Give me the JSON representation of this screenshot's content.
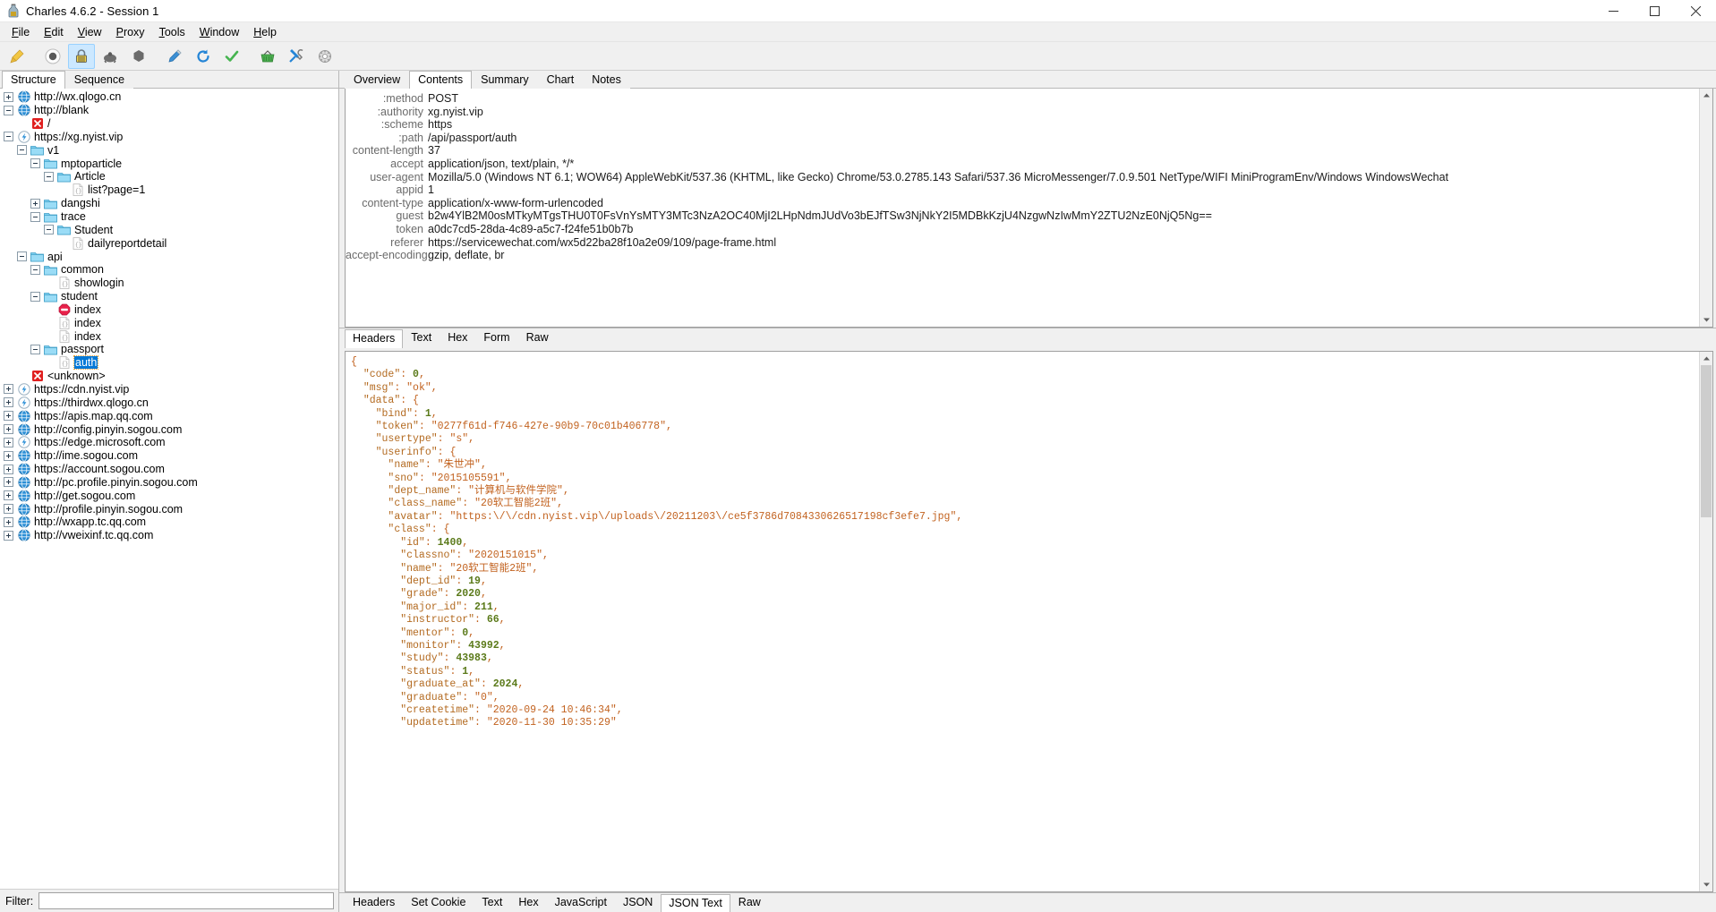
{
  "window": {
    "title": "Charles 4.6.2 - Session 1",
    "app_icon": "charles-bottle-icon",
    "minimize": "minimize-icon",
    "maximize": "maximize-icon",
    "close": "close-icon"
  },
  "menubar": [
    {
      "label": "File",
      "mnemonic": "F"
    },
    {
      "label": "Edit",
      "mnemonic": "E"
    },
    {
      "label": "View",
      "mnemonic": "V"
    },
    {
      "label": "Proxy",
      "mnemonic": "P"
    },
    {
      "label": "Tools",
      "mnemonic": "T"
    },
    {
      "label": "Window",
      "mnemonic": "W"
    },
    {
      "label": "Help",
      "mnemonic": "H"
    }
  ],
  "toolbar": [
    {
      "name": "clear-session-icon",
      "tip": "Clear the current session",
      "active": false
    },
    {
      "name": "record-icon",
      "tip": "Start/Stop Recording",
      "active": false
    },
    {
      "name": "ssl-proxying-icon",
      "tip": "SSL Proxying Settings",
      "active": true
    },
    {
      "name": "throttle-icon",
      "tip": "Start/Stop Throttling",
      "active": false
    },
    {
      "name": "breakpoints-icon",
      "tip": "Enable/Disable Breakpoints",
      "active": false
    },
    {
      "name": "compose-icon",
      "tip": "Compose a new request",
      "active": false
    },
    {
      "name": "repeat-icon",
      "tip": "Repeat the request",
      "active": false
    },
    {
      "name": "validate-icon",
      "tip": "Validate the recording",
      "active": false
    },
    {
      "name": "tools-basket-icon",
      "tip": "Tools",
      "active": false
    },
    {
      "name": "settings-tools-icon",
      "tip": "Settings",
      "active": false
    },
    {
      "name": "dns-spoofing-icon",
      "tip": "DNS Spoofing",
      "active": false
    }
  ],
  "left_pane": {
    "tabs": [
      {
        "label": "Structure",
        "selected": true
      },
      {
        "label": "Sequence",
        "selected": false
      }
    ],
    "filter": {
      "label": "Filter:",
      "value": "",
      "placeholder": ""
    },
    "tree": [
      {
        "indent": 0,
        "expander": "plus",
        "icon": "globe-icon",
        "label": "http://wx.qlogo.cn",
        "selected": false
      },
      {
        "indent": 0,
        "expander": "minus",
        "icon": "globe-icon",
        "label": "http://blank",
        "selected": false
      },
      {
        "indent": 1,
        "expander": "none",
        "icon": "error-icon",
        "label": "/",
        "selected": false
      },
      {
        "indent": 0,
        "expander": "minus",
        "icon": "ssl-icon",
        "label": "https://xg.nyist.vip",
        "selected": false
      },
      {
        "indent": 1,
        "expander": "minus",
        "icon": "folder-icon",
        "label": "v1",
        "selected": false
      },
      {
        "indent": 2,
        "expander": "minus",
        "icon": "folder-icon",
        "label": "mptoparticle",
        "selected": false
      },
      {
        "indent": 3,
        "expander": "minus",
        "icon": "folder-icon",
        "label": "Article",
        "selected": false
      },
      {
        "indent": 4,
        "expander": "none",
        "icon": "json-icon",
        "label": "list?page=1",
        "selected": false
      },
      {
        "indent": 2,
        "expander": "plus",
        "icon": "folder-icon",
        "label": "dangshi",
        "selected": false
      },
      {
        "indent": 2,
        "expander": "minus",
        "icon": "folder-icon",
        "label": "trace",
        "selected": false
      },
      {
        "indent": 3,
        "expander": "minus",
        "icon": "folder-icon",
        "label": "Student",
        "selected": false
      },
      {
        "indent": 4,
        "expander": "none",
        "icon": "json-icon",
        "label": "dailyreportdetail",
        "selected": false
      },
      {
        "indent": 1,
        "expander": "minus",
        "icon": "folder-icon",
        "label": "api",
        "selected": false
      },
      {
        "indent": 2,
        "expander": "minus",
        "icon": "folder-icon",
        "label": "common",
        "selected": false
      },
      {
        "indent": 3,
        "expander": "none",
        "icon": "json-icon",
        "label": "showlogin",
        "selected": false
      },
      {
        "indent": 2,
        "expander": "minus",
        "icon": "folder-icon",
        "label": "student",
        "selected": false
      },
      {
        "indent": 3,
        "expander": "none",
        "icon": "stop-icon",
        "label": "index",
        "selected": false
      },
      {
        "indent": 3,
        "expander": "none",
        "icon": "json-icon",
        "label": "index",
        "selected": false
      },
      {
        "indent": 3,
        "expander": "none",
        "icon": "json-icon",
        "label": "index",
        "selected": false
      },
      {
        "indent": 2,
        "expander": "minus",
        "icon": "folder-icon",
        "label": "passport",
        "selected": false
      },
      {
        "indent": 3,
        "expander": "none",
        "icon": "json-icon",
        "label": "auth",
        "selected": true
      },
      {
        "indent": 1,
        "expander": "none",
        "icon": "error-icon",
        "label": "<unknown>",
        "selected": false
      },
      {
        "indent": 0,
        "expander": "plus",
        "icon": "ssl-icon",
        "label": "https://cdn.nyist.vip",
        "selected": false
      },
      {
        "indent": 0,
        "expander": "plus",
        "icon": "ssl-icon",
        "label": "https://thirdwx.qlogo.cn",
        "selected": false
      },
      {
        "indent": 0,
        "expander": "plus",
        "icon": "globe-icon",
        "label": "https://apis.map.qq.com",
        "selected": false
      },
      {
        "indent": 0,
        "expander": "plus",
        "icon": "globe-icon",
        "label": "http://config.pinyin.sogou.com",
        "selected": false
      },
      {
        "indent": 0,
        "expander": "plus",
        "icon": "ssl-icon",
        "label": "https://edge.microsoft.com",
        "selected": false
      },
      {
        "indent": 0,
        "expander": "plus",
        "icon": "globe-icon",
        "label": "http://ime.sogou.com",
        "selected": false
      },
      {
        "indent": 0,
        "expander": "plus",
        "icon": "globe-icon",
        "label": "https://account.sogou.com",
        "selected": false
      },
      {
        "indent": 0,
        "expander": "plus",
        "icon": "globe-icon",
        "label": "http://pc.profile.pinyin.sogou.com",
        "selected": false
      },
      {
        "indent": 0,
        "expander": "plus",
        "icon": "globe-icon",
        "label": "http://get.sogou.com",
        "selected": false
      },
      {
        "indent": 0,
        "expander": "plus",
        "icon": "globe-icon",
        "label": "http://profile.pinyin.sogou.com",
        "selected": false
      },
      {
        "indent": 0,
        "expander": "plus",
        "icon": "globe-icon",
        "label": "http://wxapp.tc.qq.com",
        "selected": false
      },
      {
        "indent": 0,
        "expander": "plus",
        "icon": "globe-icon",
        "label": "http://vweixinf.tc.qq.com",
        "selected": false
      }
    ]
  },
  "request": {
    "tabs": [
      {
        "label": "Overview",
        "selected": false
      },
      {
        "label": "Contents",
        "selected": true
      },
      {
        "label": "Summary",
        "selected": false
      },
      {
        "label": "Chart",
        "selected": false
      },
      {
        "label": "Notes",
        "selected": false
      }
    ],
    "sub_tabs": [
      {
        "label": "Headers",
        "selected": true
      },
      {
        "label": "Text",
        "selected": false
      },
      {
        "label": "Hex",
        "selected": false
      },
      {
        "label": "Form",
        "selected": false
      },
      {
        "label": "Raw",
        "selected": false
      }
    ],
    "headers": [
      {
        "name": ":method",
        "value": "POST"
      },
      {
        "name": ":authority",
        "value": "xg.nyist.vip"
      },
      {
        "name": ":scheme",
        "value": "https"
      },
      {
        "name": ":path",
        "value": "/api/passport/auth"
      },
      {
        "name": "content-length",
        "value": "37"
      },
      {
        "name": "accept",
        "value": "application/json, text/plain, */*"
      },
      {
        "name": "user-agent",
        "value": "Mozilla/5.0 (Windows NT 6.1; WOW64) AppleWebKit/537.36 (KHTML, like Gecko) Chrome/53.0.2785.143 Safari/537.36 MicroMessenger/7.0.9.501 NetType/WIFI MiniProgramEnv/Windows WindowsWechat"
      },
      {
        "name": "appid",
        "value": "1"
      },
      {
        "name": "content-type",
        "value": "application/x-www-form-urlencoded"
      },
      {
        "name": "guest",
        "value": "b2w4YlB2M0osMTkyMTgsTHU0T0FsVnYsMTY3MTc3NzA2OC40MjI2LHpNdmJUdVo3bEJfTSw3NjNkY2I5MDBkKzjU4NzgwNzIwMmY2ZTU2NzE0NjQ5Ng=="
      },
      {
        "name": "token",
        "value": "a0dc7cd5-28da-4c89-a5c7-f24fe51b0b7b"
      },
      {
        "name": "referer",
        "value": "https://servicewechat.com/wx5d22ba28f10a2e09/109/page-frame.html"
      },
      {
        "name": "accept-encoding",
        "value": "gzip, deflate, br"
      }
    ]
  },
  "response": {
    "tabs": [
      {
        "label": "Headers",
        "selected": false
      },
      {
        "label": "Set Cookie",
        "selected": false
      },
      {
        "label": "Text",
        "selected": false
      },
      {
        "label": "Hex",
        "selected": false
      },
      {
        "label": "JavaScript",
        "selected": false
      },
      {
        "label": "JSON",
        "selected": false
      },
      {
        "label": "JSON Text",
        "selected": true
      },
      {
        "label": "Raw",
        "selected": false
      }
    ],
    "json_lines": [
      {
        "indent": 0,
        "text": "{",
        "type": "punc"
      },
      {
        "indent": 1,
        "key": "code",
        "value": "0",
        "type": "num",
        "comma": true
      },
      {
        "indent": 1,
        "key": "msg",
        "value": "ok",
        "type": "str",
        "comma": true
      },
      {
        "indent": 1,
        "key": "data",
        "value": "{",
        "type": "open"
      },
      {
        "indent": 2,
        "key": "bind",
        "value": "1",
        "type": "num",
        "comma": true
      },
      {
        "indent": 2,
        "key": "token",
        "value": "0277f61d-f746-427e-90b9-70c01b406778",
        "type": "str",
        "comma": true
      },
      {
        "indent": 2,
        "key": "usertype",
        "value": "s",
        "type": "str",
        "comma": true
      },
      {
        "indent": 2,
        "key": "userinfo",
        "value": "{",
        "type": "open"
      },
      {
        "indent": 3,
        "key": "name",
        "value": "朱世冲",
        "type": "str",
        "comma": true
      },
      {
        "indent": 3,
        "key": "sno",
        "value": "2015105591",
        "type": "str",
        "comma": true
      },
      {
        "indent": 3,
        "key": "dept_name",
        "value": "计算机与软件学院",
        "type": "str",
        "comma": true
      },
      {
        "indent": 3,
        "key": "class_name",
        "value": "20软工智能2班",
        "type": "str",
        "comma": true
      },
      {
        "indent": 3,
        "key": "avatar",
        "value": "https:\\/\\/cdn.nyist.vip\\/uploads\\/20211203\\/ce5f3786d7084330626517198cf3efe7.jpg",
        "type": "str",
        "comma": true
      },
      {
        "indent": 3,
        "key": "class",
        "value": "{",
        "type": "open"
      },
      {
        "indent": 4,
        "key": "id",
        "value": "1400",
        "type": "num",
        "comma": true
      },
      {
        "indent": 4,
        "key": "classno",
        "value": "2020151015",
        "type": "str",
        "comma": true
      },
      {
        "indent": 4,
        "key": "name",
        "value": "20软工智能2班",
        "type": "str",
        "comma": true
      },
      {
        "indent": 4,
        "key": "dept_id",
        "value": "19",
        "type": "num",
        "comma": true
      },
      {
        "indent": 4,
        "key": "grade",
        "value": "2020",
        "type": "num",
        "comma": true
      },
      {
        "indent": 4,
        "key": "major_id",
        "value": "211",
        "type": "num",
        "comma": true
      },
      {
        "indent": 4,
        "key": "instructor",
        "value": "66",
        "type": "num",
        "comma": true
      },
      {
        "indent": 4,
        "key": "mentor",
        "value": "0",
        "type": "num",
        "comma": true
      },
      {
        "indent": 4,
        "key": "monitor",
        "value": "43992",
        "type": "num",
        "comma": true
      },
      {
        "indent": 4,
        "key": "study",
        "value": "43983",
        "type": "num",
        "comma": true
      },
      {
        "indent": 4,
        "key": "status",
        "value": "1",
        "type": "num",
        "comma": true
      },
      {
        "indent": 4,
        "key": "graduate_at",
        "value": "2024",
        "type": "num",
        "comma": true
      },
      {
        "indent": 4,
        "key": "graduate",
        "value": "0",
        "type": "str",
        "comma": true
      },
      {
        "indent": 4,
        "key": "createtime",
        "value": "2020-09-24 10:46:34",
        "type": "str",
        "comma": true
      },
      {
        "indent": 4,
        "key": "updatetime",
        "value": "2020-11-30 10:35:29",
        "type": "str",
        "comma": false
      }
    ]
  },
  "colors": {
    "accent": "#0078d7",
    "selection": "#0078d7",
    "tab_active_bg": "#ffffff",
    "json_key": "#b36a20",
    "json_string": "#c2621f",
    "json_number": "#5b7a1a",
    "header_name": "#6b6b6b",
    "toolbar_active": "#cce8ff"
  }
}
